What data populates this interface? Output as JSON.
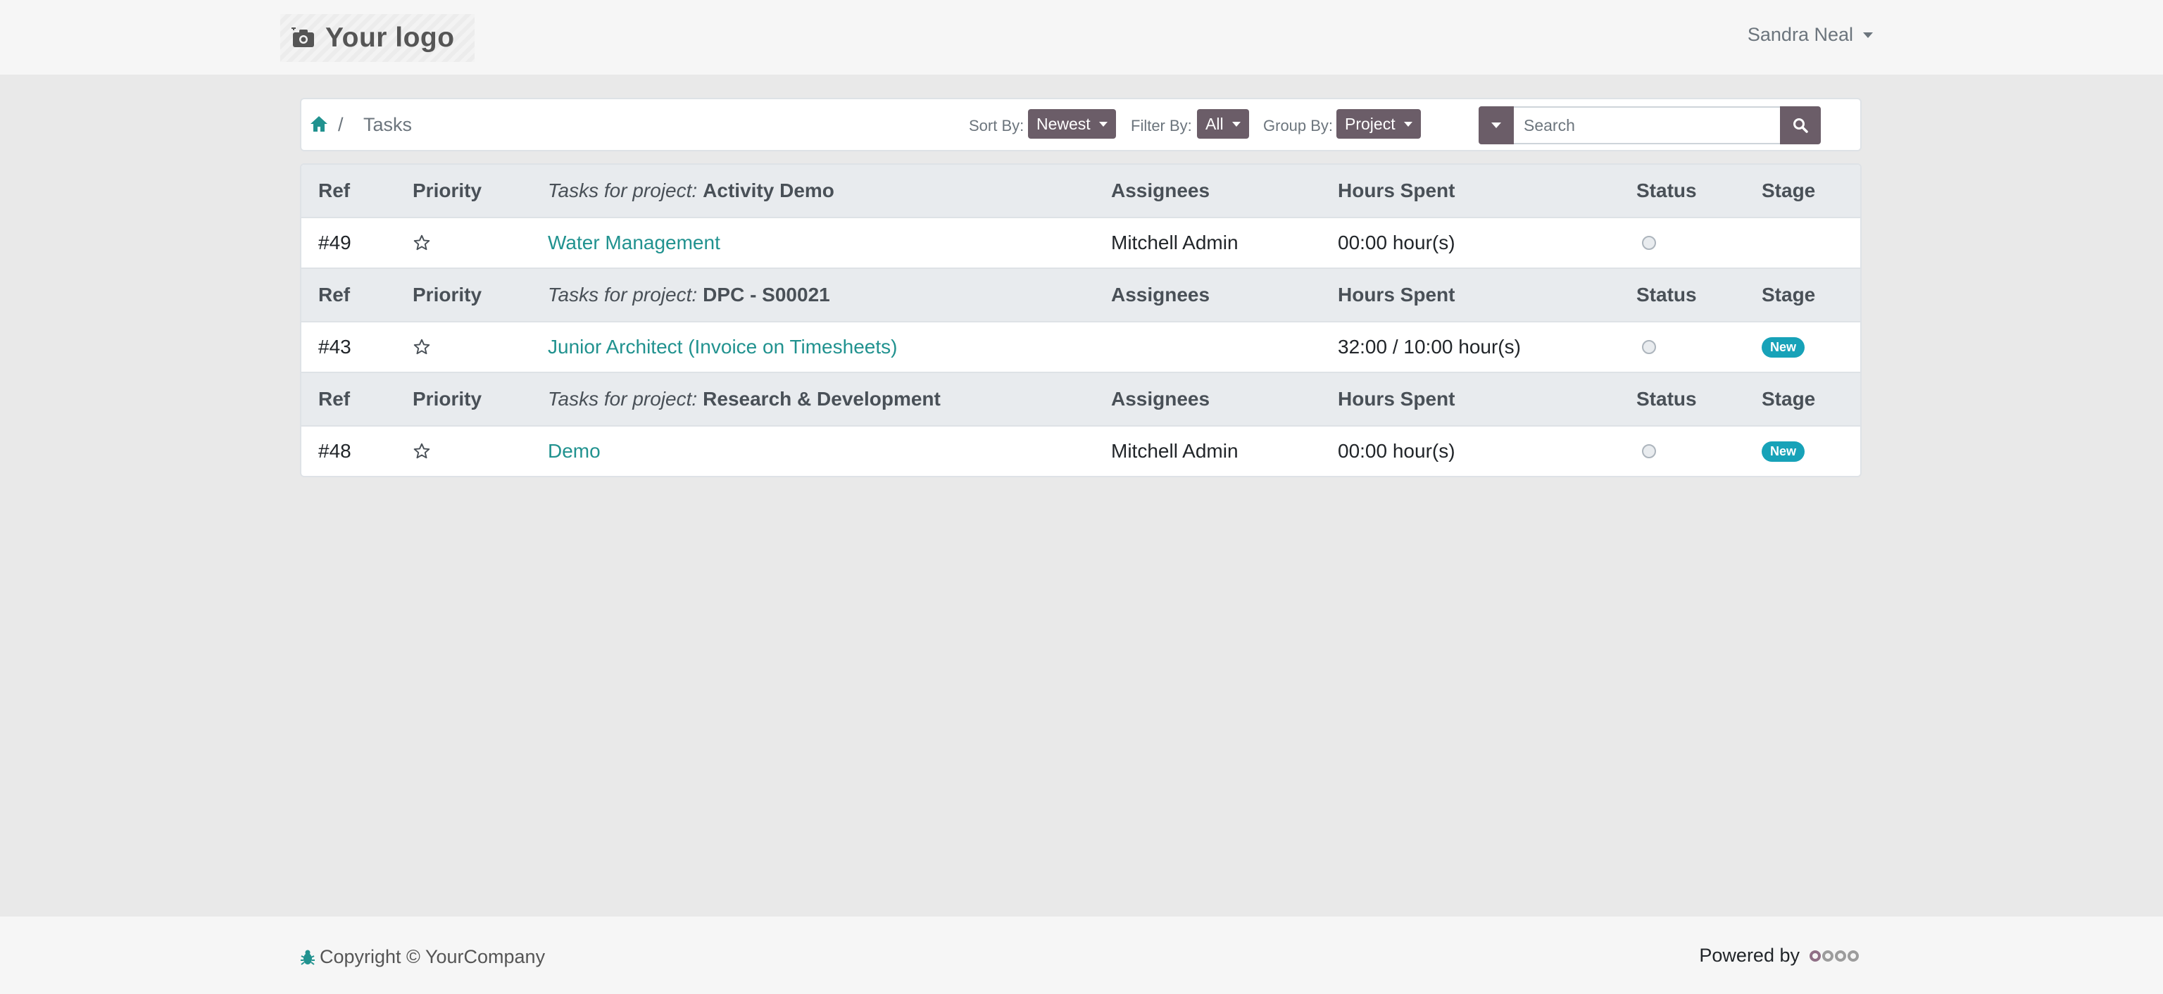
{
  "header": {
    "logo_text": "Your logo",
    "user_name": "Sandra Neal"
  },
  "breadcrumb": {
    "separator": "/",
    "current": "Tasks"
  },
  "controls": {
    "sort_label": "Sort By:",
    "sort_value": "Newest",
    "filter_label": "Filter By:",
    "filter_value": "All",
    "group_label": "Group By:",
    "group_value": "Project",
    "search_placeholder": "Search"
  },
  "table": {
    "columns": {
      "ref": "Ref",
      "priority": "Priority",
      "project_prefix": "Tasks for project:",
      "assignees": "Assignees",
      "hours": "Hours Spent",
      "status": "Status",
      "stage": "Stage"
    },
    "groups": [
      {
        "project": "Activity Demo",
        "task": {
          "ref": "#49",
          "name": "Water Management",
          "assignees": "Mitchell Admin",
          "hours": "00:00 hour(s)",
          "stage": ""
        }
      },
      {
        "project": "DPC - S00021",
        "task": {
          "ref": "#43",
          "name": "Junior Architect (Invoice on Timesheets)",
          "assignees": "",
          "hours": "32:00 / 10:00 hour(s)",
          "stage": "New"
        }
      },
      {
        "project": "Research & Development",
        "task": {
          "ref": "#48",
          "name": "Demo",
          "assignees": "Mitchell Admin",
          "hours": "00:00 hour(s)",
          "stage": "New"
        }
      }
    ]
  },
  "footer": {
    "copyright": "Copyright © YourCompany",
    "powered_by": "Powered by"
  },
  "colors": {
    "accent": "#21928f",
    "button": "#6b5d68",
    "badge": "#17a2b8",
    "background": "#e9e9e9"
  }
}
